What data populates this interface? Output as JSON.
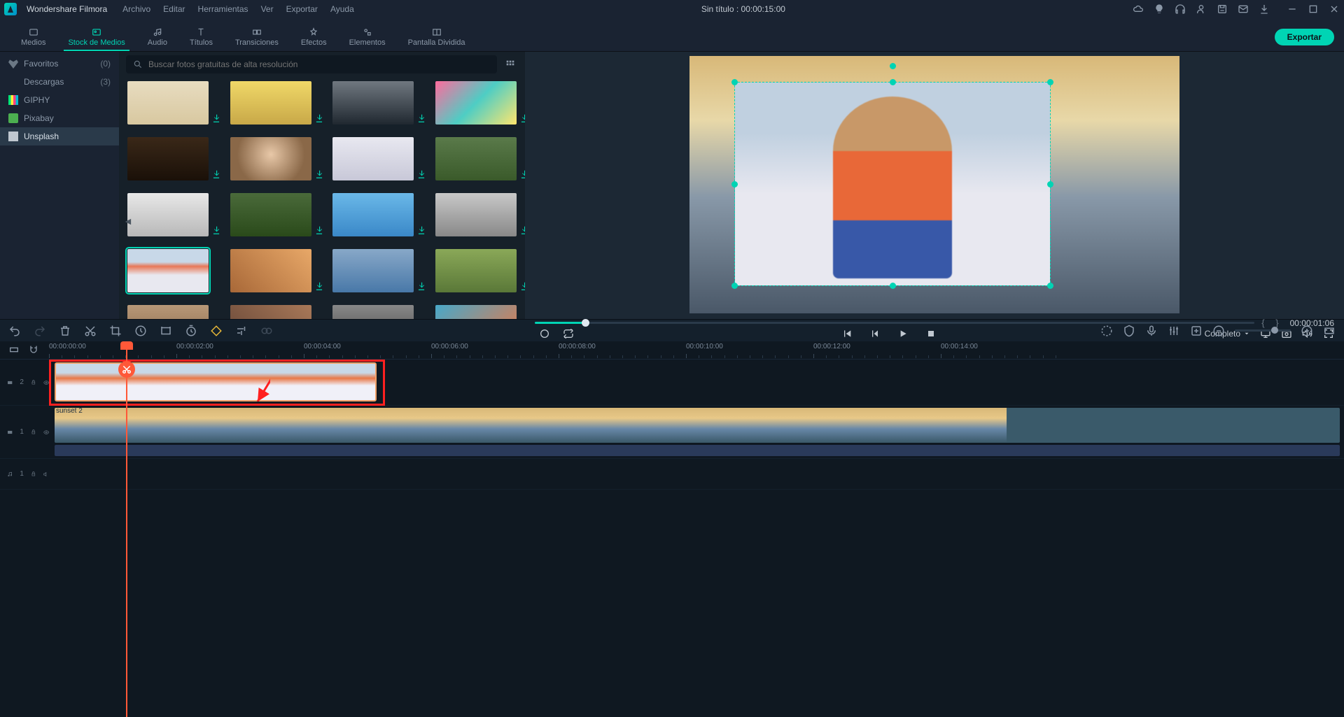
{
  "app": {
    "name": "Wondershare Filmora"
  },
  "menu": [
    "Archivo",
    "Editar",
    "Herramientas",
    "Ver",
    "Exportar",
    "Ayuda"
  ],
  "title_center": "Sin título : 00:00:15:00",
  "tabs": [
    {
      "id": "medios",
      "label": "Medios"
    },
    {
      "id": "stock",
      "label": "Stock de Medios"
    },
    {
      "id": "audio",
      "label": "Audio"
    },
    {
      "id": "titulos",
      "label": "Títulos"
    },
    {
      "id": "transiciones",
      "label": "Transiciones"
    },
    {
      "id": "efectos",
      "label": "Efectos"
    },
    {
      "id": "elementos",
      "label": "Elementos"
    },
    {
      "id": "pantalla",
      "label": "Pantalla Dividida"
    }
  ],
  "active_tab": "stock",
  "export_label": "Exportar",
  "sidebar": {
    "items": [
      {
        "id": "fav",
        "label": "Favoritos",
        "count": "(0)",
        "icon": "heart"
      },
      {
        "id": "desc",
        "label": "Descargas",
        "count": "(3)",
        "icon": ""
      },
      {
        "id": "giphy",
        "label": "GIPHY",
        "icon": "giphy"
      },
      {
        "id": "pixabay",
        "label": "Pixabay",
        "icon": "pixabay"
      },
      {
        "id": "unsplash",
        "label": "Unsplash",
        "icon": "unsplash"
      }
    ],
    "selected": "unsplash"
  },
  "search": {
    "placeholder": "Buscar fotos gratuitas de alta resolución"
  },
  "thumbs_selected_index": 12,
  "preview": {
    "timecode": "00:00:01:06",
    "quality_label": "Completo"
  },
  "timeline": {
    "ruler_marks": [
      "00:00:00:00",
      "00:00:02:00",
      "00:00:04:00",
      "00:00:06:00",
      "00:00:08:00",
      "00:00:10:00",
      "00:00:12:00",
      "00:00:14:00"
    ],
    "tracks": {
      "v2": {
        "name": "2"
      },
      "v1": {
        "name": "1",
        "clip_label": "sunset 2"
      },
      "a1": {
        "name": "1"
      }
    }
  }
}
